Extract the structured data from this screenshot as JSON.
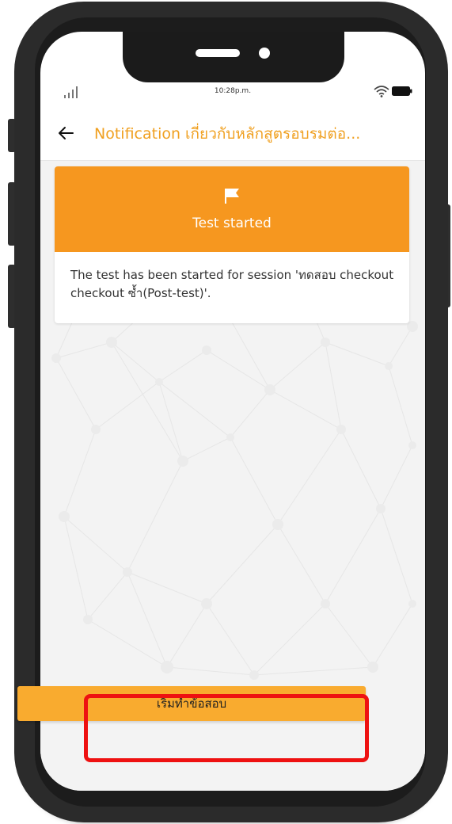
{
  "status_bar": {
    "time": "10:28p.m.",
    "icons": [
      "signal-icon",
      "wifi-icon",
      "battery-icon"
    ]
  },
  "header": {
    "back_icon": "back-arrow-icon",
    "title": "Notification เกี่ยวกับหลักสูตรอบรมต่อ..."
  },
  "notification": {
    "icon": "flag-icon",
    "title": "Test started",
    "message": "The test has been started for session 'ทดสอบ checkout checkout ซ้ำ(Post-test)'."
  },
  "action": {
    "start_label": "เริ่มทำข้อสอบ"
  },
  "colors": {
    "accent": "#f6971f",
    "title_text": "#f0a020",
    "button": "#f9ab2f",
    "highlight": "#ee1111"
  }
}
